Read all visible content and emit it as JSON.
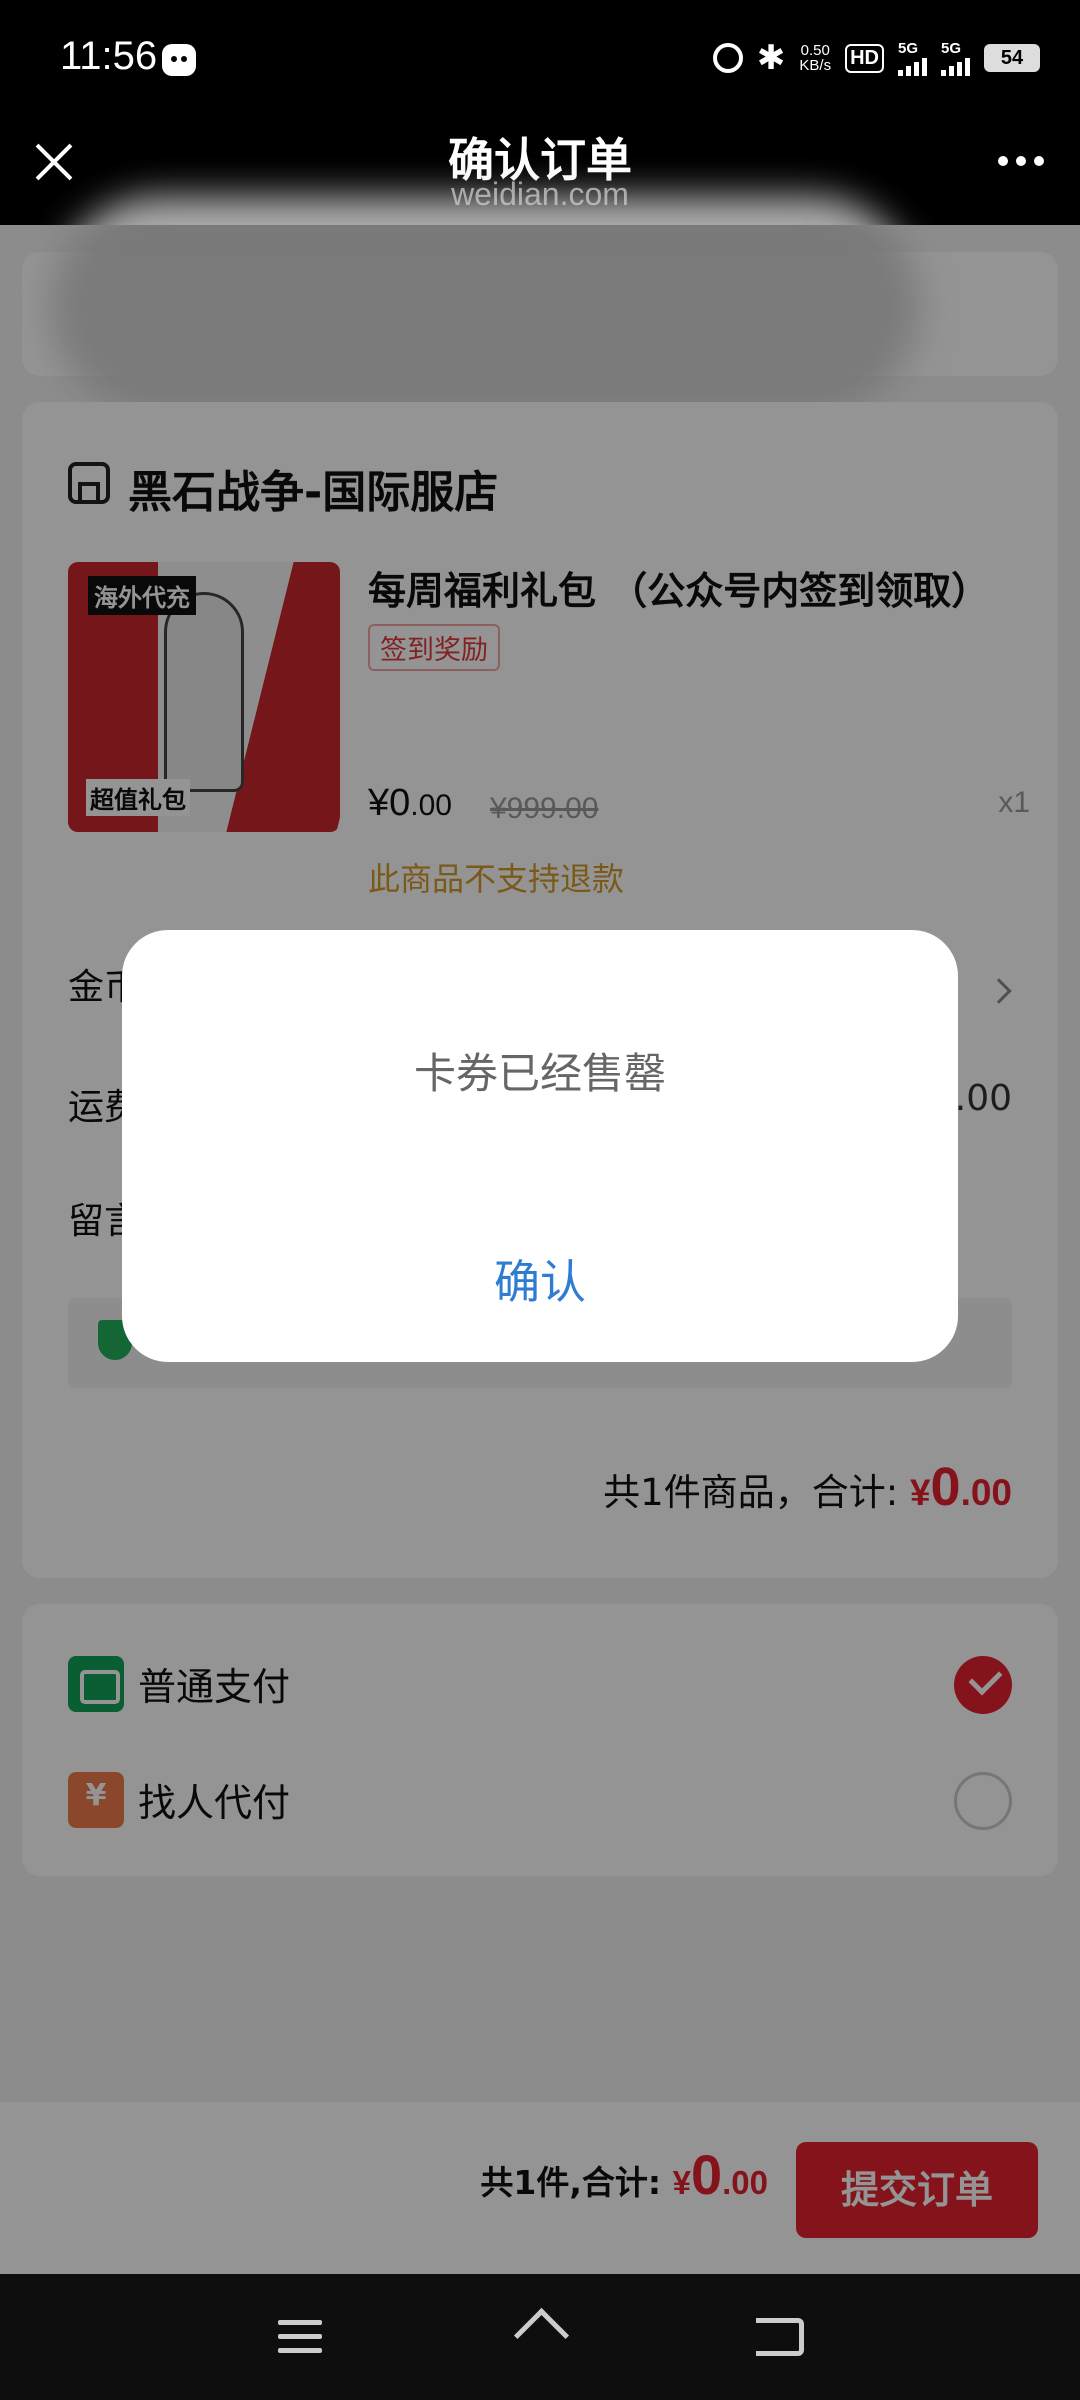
{
  "status_bar": {
    "time": "11:56",
    "net_speed": "0.50",
    "net_unit": "KB/s",
    "hd": "HD",
    "sim1": "5G",
    "sim2": "5G",
    "battery": "54"
  },
  "nav": {
    "title": "确认订单",
    "subtitle": "weidian.com"
  },
  "shop": {
    "name": "黑石战争-国际服店"
  },
  "product": {
    "title": "每周福利礼包 （公众号内签到领取）",
    "tag": "签到奖励",
    "price_symbol": "¥",
    "price_int": "0",
    "price_dec": ".00",
    "original_price": "¥999.00",
    "quantity": "x1",
    "refund_note": "此商品不支持退款",
    "image_text_top": "海外代充",
    "image_text_bottom": "超值礼包"
  },
  "rows": {
    "coin_label": "金币",
    "shipping_label": "运费",
    "shipping_value": "¥0.00",
    "message_label": "留言"
  },
  "summary": {
    "count_text": "共1件商品，合计:",
    "symbol": "¥",
    "int": "0",
    "dec": ".00"
  },
  "payment": {
    "options": [
      {
        "label": "普通支付",
        "selected": true,
        "icon": "wallet-icon"
      },
      {
        "label": "找人代付",
        "selected": false,
        "icon": "pay-for-me-icon"
      }
    ]
  },
  "bottom_bar": {
    "count_text": "共1件,合计:",
    "symbol": "¥",
    "int": "0",
    "dec": ".00",
    "submit_label": "提交订单"
  },
  "dialog": {
    "message": "卡券已经售罄",
    "confirm_label": "确认"
  },
  "colors": {
    "accent": "#e5222f",
    "dialog_button": "#2f7dd1",
    "refund_note": "#d49a2c",
    "pay_green": "#12a35a",
    "pay_orange": "#f07a4a"
  }
}
